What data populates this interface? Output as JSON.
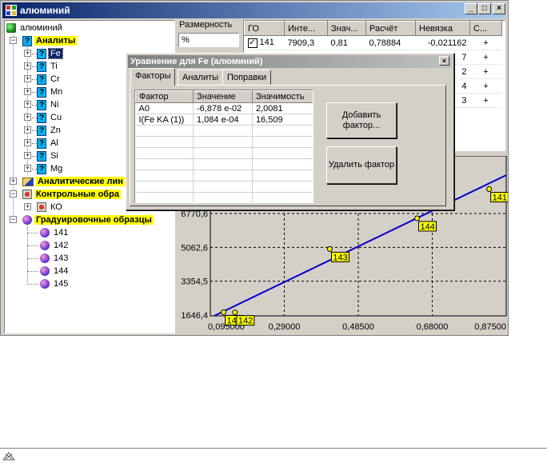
{
  "window": {
    "title": "алюминий"
  },
  "tree": {
    "root": "алюминий",
    "analytes_label": "Аналиты",
    "analytes": [
      "Fe",
      "Ti",
      "Cr",
      "Mn",
      "Ni",
      "Cu",
      "Zn",
      "Al",
      "Si",
      "Mg"
    ],
    "analytical_lines_label": "Аналитические лин",
    "control_samples_label": "Контрольные обра",
    "control_samples": [
      "КО"
    ],
    "calibration_samples_label": "Градуировочные образцы",
    "calibration_samples": [
      "141",
      "142",
      "143",
      "144",
      "145"
    ]
  },
  "dimension": {
    "label": "Размерность",
    "value": "%"
  },
  "grid": {
    "columns": [
      "ГО",
      "Инте...",
      "Знач...",
      "Расчёт",
      "Невязка",
      "С..."
    ],
    "rows": [
      [
        "141",
        "7909,3",
        "0,81",
        "0,78884",
        "-0,021162",
        "+"
      ],
      [
        "",
        "",
        "",
        "",
        "7",
        "+"
      ],
      [
        "",
        "",
        "",
        "",
        "2",
        "+"
      ],
      [
        "",
        "",
        "",
        "",
        "4",
        "+"
      ],
      [
        "",
        "",
        "",
        "",
        "3",
        "+"
      ]
    ]
  },
  "dialog": {
    "title": "Уравнение для Fe (алюминий)",
    "tabs": [
      "Факторы",
      "Аналиты",
      "Поправки"
    ],
    "columns": [
      "Фактор",
      "Значение",
      "Значимость"
    ],
    "rows": [
      [
        "A0",
        "-6,878 e-02",
        "2,0081"
      ],
      [
        "I(Fe KA (1))",
        "1,084 e-04",
        "16,509"
      ]
    ],
    "add_button": "Добавить фактор...",
    "delete_button": "Удалить фактор"
  },
  "chart_data": {
    "type": "scatter",
    "x_ticks": [
      "0,095000",
      "0,29000",
      "0,48500",
      "0,68000",
      "0,87500"
    ],
    "y_ticks": [
      "1646,4",
      "3354,5",
      "5062,6",
      "6770,6"
    ],
    "xlim": [
      0.095,
      0.875
    ],
    "ylim": [
      1646.4,
      6770.6
    ],
    "points": [
      {
        "label": "145",
        "x": 0.13,
        "y": 1790
      },
      {
        "label": "142",
        "x": 0.16,
        "y": 1780
      },
      {
        "label": "143",
        "x": 0.41,
        "y": 4980
      },
      {
        "label": "144",
        "x": 0.64,
        "y": 6530
      },
      {
        "label": "141",
        "x": 0.83,
        "y": 8000
      }
    ],
    "fit_line": {
      "x": [
        0.095,
        0.875
      ],
      "y": [
        1511,
        8706
      ]
    },
    "grid": true,
    "colors": {
      "line": "#0000cc",
      "point": "#ffff00",
      "label_bg": "#ffff00",
      "background": "#d4d0c8"
    }
  },
  "colors": {
    "title_active": "#0a246a",
    "highlight": "#ffff00",
    "selection": "#0a246a"
  },
  "status": {
    "icon": "network-icon"
  }
}
